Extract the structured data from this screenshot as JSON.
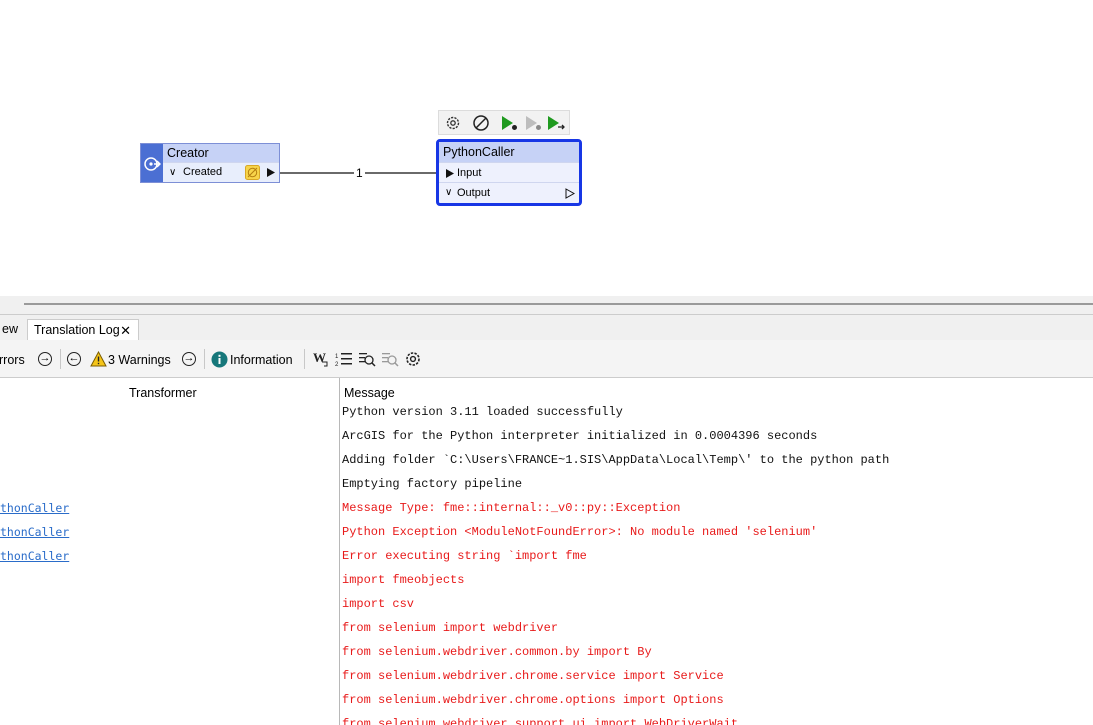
{
  "canvas": {
    "creator": {
      "title": "Creator",
      "port": "Created"
    },
    "python_caller": {
      "title": "PythonCaller",
      "input_port": "Input",
      "output_port": "Output"
    },
    "connection_label": "1",
    "toolbar_icons": [
      "gear-icon",
      "disable-icon",
      "run-to-this-icon",
      "run-from-this-icon",
      "run-just-this-icon"
    ],
    "colors": {
      "node_header": "#c6d2f6",
      "node_body": "#e8eefc",
      "selected_border": "#1736e5",
      "creator_strip": "#4b6fd3"
    }
  },
  "tabs": [
    {
      "label": "ew"
    },
    {
      "label": "Translation Log",
      "active": true
    }
  ],
  "log_toolbar": {
    "errors_label": "rrors",
    "warnings_label": "3 Warnings",
    "information_label": "Information"
  },
  "log_table": {
    "columns": {
      "transformer": "Transformer",
      "message": "Message"
    },
    "rows": [
      {
        "transformer": "",
        "message": "Python version 3.11 loaded successfully",
        "level": "info"
      },
      {
        "transformer": "",
        "message": "ArcGIS for the Python interpreter initialized in 0.0004396 seconds",
        "level": "info"
      },
      {
        "transformer": "",
        "message": "Adding folder `C:\\Users\\FRANCE~1.SIS\\AppData\\Local\\Temp\\' to the python path",
        "level": "info"
      },
      {
        "transformer": "",
        "message": "Emptying factory pipeline",
        "level": "info"
      },
      {
        "transformer": "thonCaller",
        "message": "Message Type: fme::internal::_v0::py::Exception",
        "level": "error"
      },
      {
        "transformer": "thonCaller",
        "message": "Python Exception <ModuleNotFoundError>: No module named 'selenium'",
        "level": "error"
      },
      {
        "transformer": "thonCaller",
        "message": "Error executing string `import fme",
        "level": "error"
      },
      {
        "transformer": "",
        "message": "import fmeobjects",
        "level": "error"
      },
      {
        "transformer": "",
        "message": "import csv",
        "level": "error"
      },
      {
        "transformer": "",
        "message": "from selenium import webdriver",
        "level": "error"
      },
      {
        "transformer": "",
        "message": "from selenium.webdriver.common.by import By",
        "level": "error"
      },
      {
        "transformer": "",
        "message": "from selenium.webdriver.chrome.service import Service",
        "level": "error"
      },
      {
        "transformer": "",
        "message": "from selenium.webdriver.chrome.options import Options",
        "level": "error"
      },
      {
        "transformer": "",
        "message": "from selenium.webdriver.support.ui import WebDriverWait",
        "level": "error"
      }
    ]
  }
}
